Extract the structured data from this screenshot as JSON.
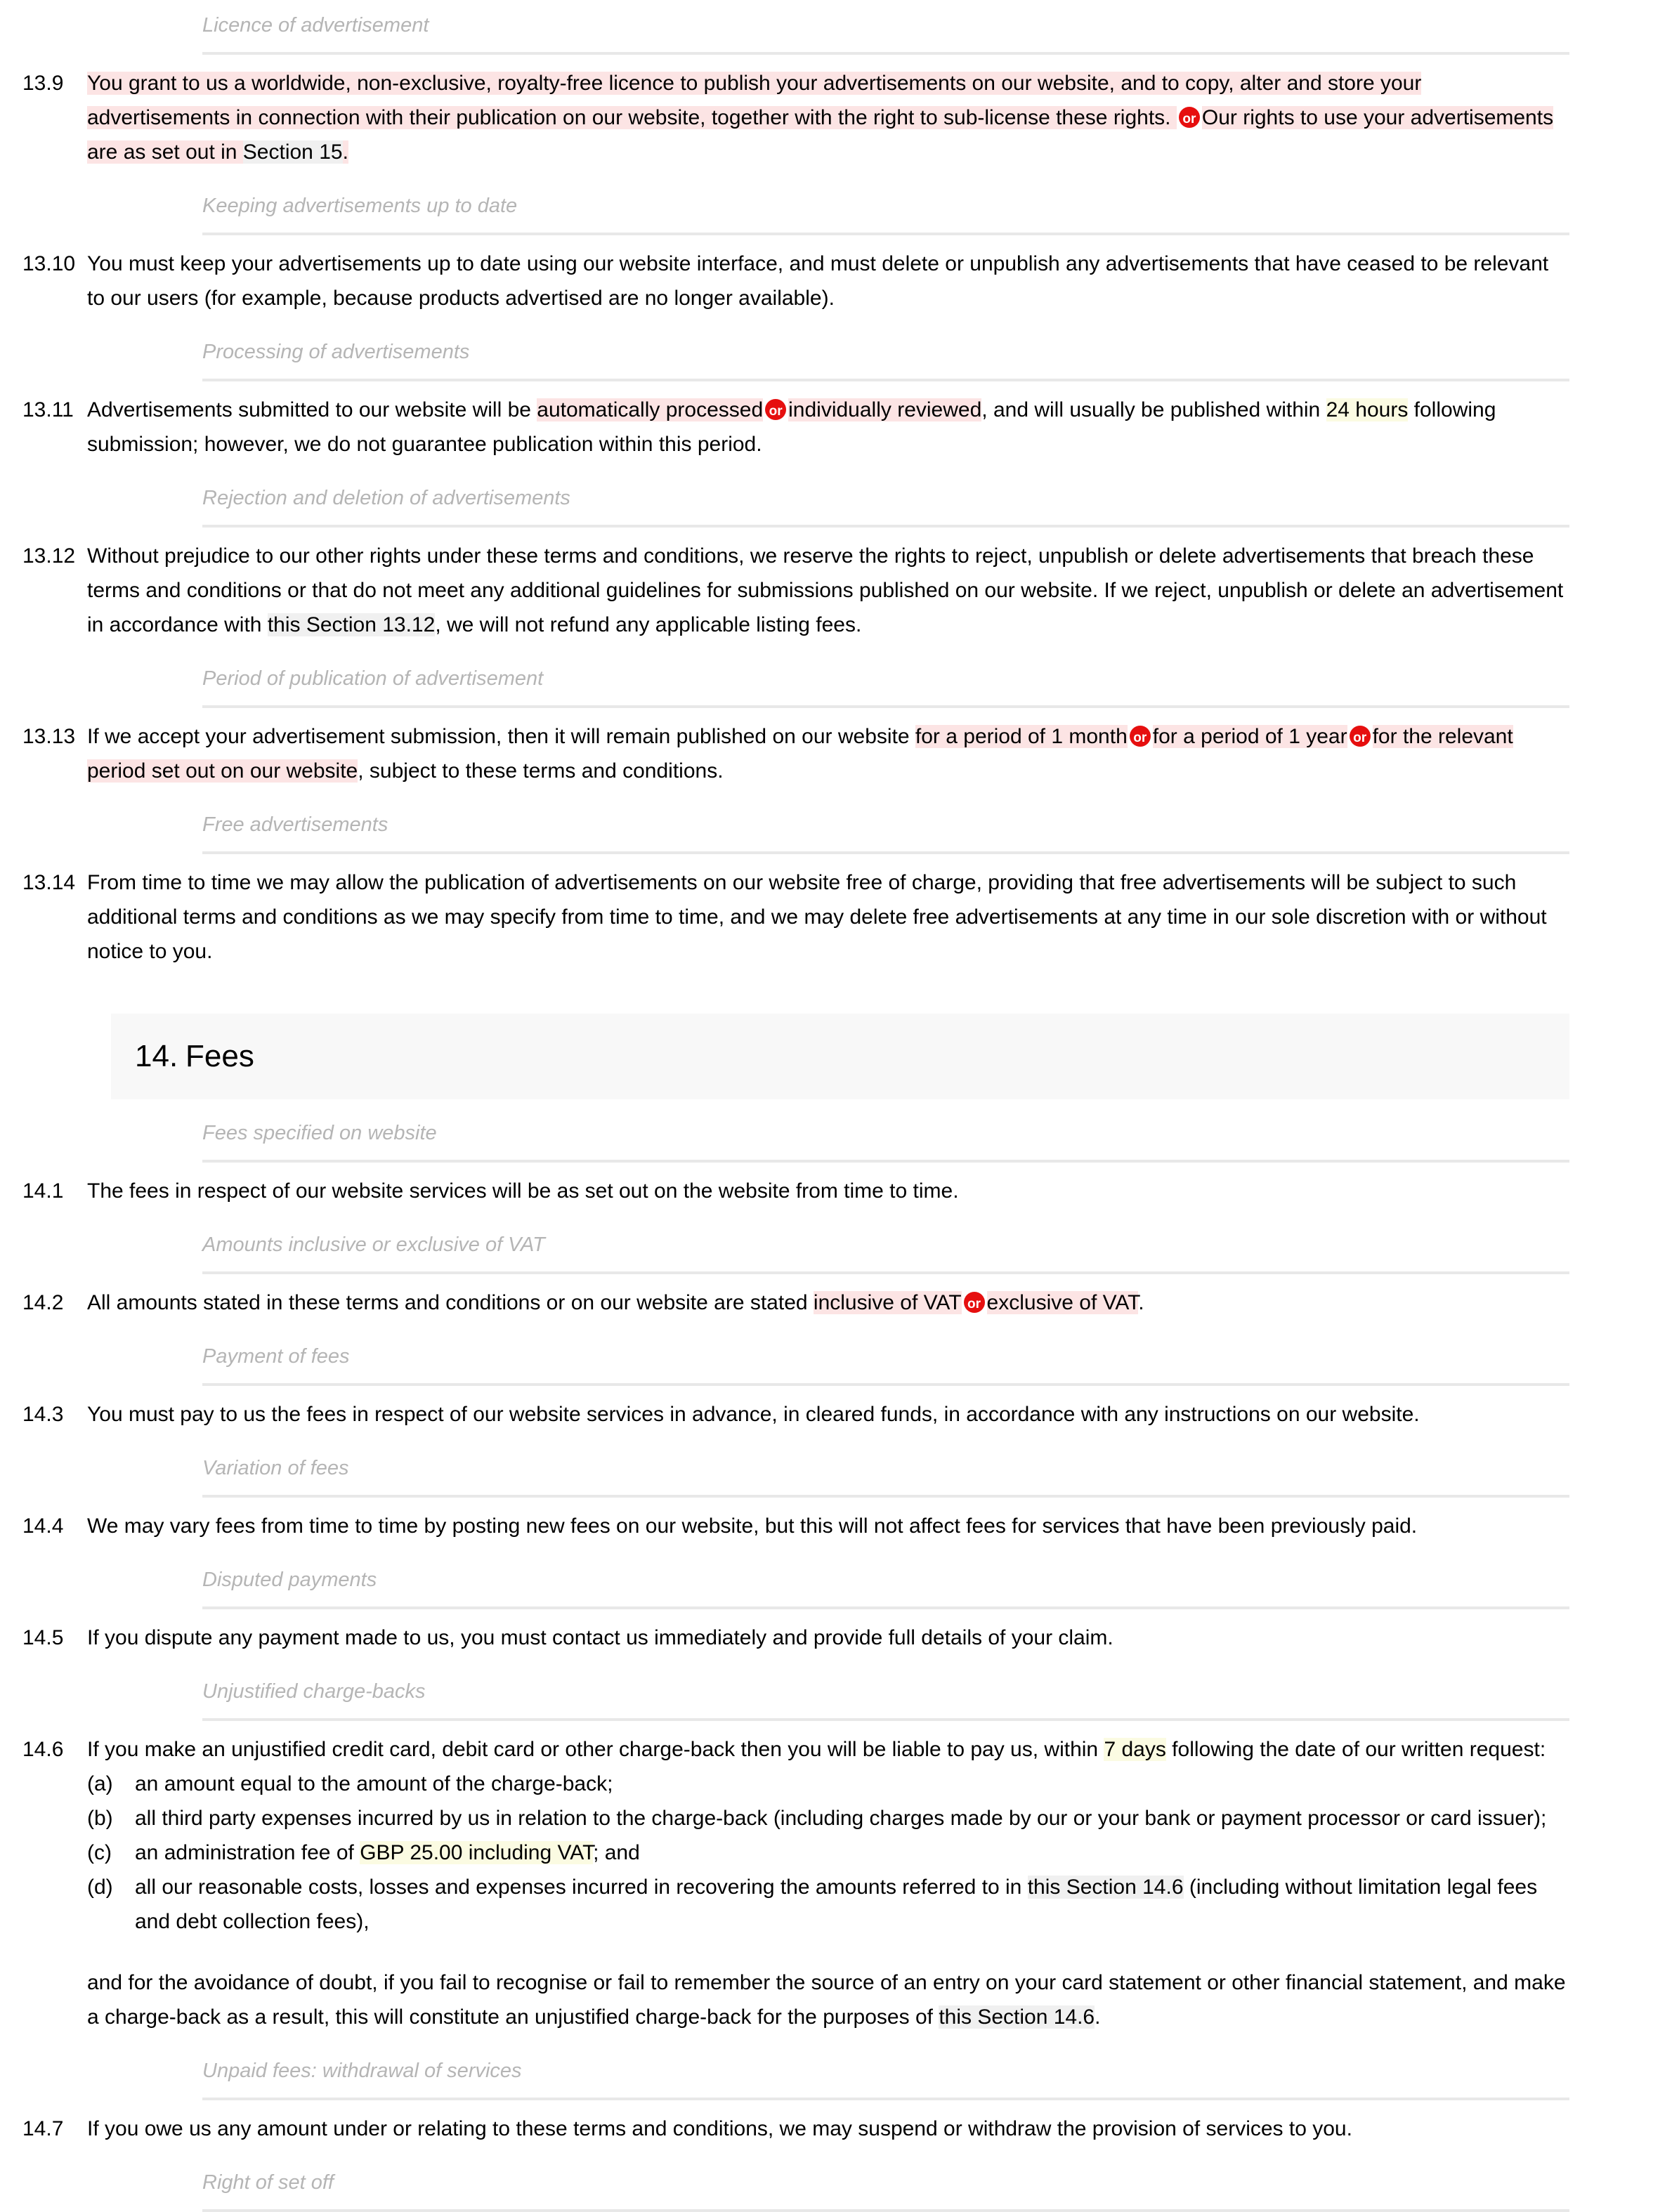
{
  "document": {
    "type": "terms-and-conditions",
    "colors": {
      "option_highlight": "#fce4e4",
      "variable_highlight": "#fbfbe2",
      "crossref_highlight": "#f0f0f0",
      "or_badge": "#e60f0f",
      "subheading": "#b5b5b5",
      "section_banner": "#f8f8f8",
      "rule": "#e8e8e8"
    },
    "or_badge_label": "or"
  },
  "blocks": {
    "sub_licence": "Licence of advertisement",
    "c13_9_num": "13.9",
    "c13_9_a": "You grant to us a worldwide, non-exclusive, royalty-free licence to publish your advertisements on our website, and to copy, alter and store your advertisements in connection with their publication on our website, together with the right to sub-license these rights. ",
    "c13_9_b": "Our rights to use your advertisements are as set out in ",
    "c13_9_xref": "Section 15",
    "c13_9_c": ".",
    "sub_keeping": "Keeping advertisements up to date",
    "c13_10_num": "13.10",
    "c13_10": "You must keep your advertisements up to date using our website interface, and must delete or unpublish any advertisements that have ceased to be relevant to our users (for example, because products advertised are no longer available).",
    "sub_processing": "Processing of advertisements",
    "c13_11_num": "13.11",
    "c13_11_a": "Advertisements submitted to our website will be ",
    "c13_11_opt1": "automatically processed",
    "c13_11_opt2": "individually reviewed",
    "c13_11_b": ", and will usually be published within ",
    "c13_11_var": "24 hours",
    "c13_11_c": " following submission; however, we do not guarantee publication within this period.",
    "sub_rejection": "Rejection and deletion of advertisements",
    "c13_12_num": "13.12",
    "c13_12_a": "Without prejudice to our other rights under these terms and conditions, we reserve the rights to reject, unpublish or delete advertisements that breach these terms and conditions or that do not meet any additional guidelines for submissions published on our website. If we reject, unpublish or delete an advertisement in accordance with ",
    "c13_12_xref": "this Section 13.12",
    "c13_12_b": ", we will not refund any applicable listing fees.",
    "sub_period": "Period of publication of advertisement",
    "c13_13_num": "13.13",
    "c13_13_a": "If we accept your advertisement submission, then it will remain published on our website ",
    "c13_13_opt1": "for a period of 1 month",
    "c13_13_opt2": "for a period of 1 year",
    "c13_13_opt3": "for the relevant period set out on our website",
    "c13_13_b": ", subject to these terms and conditions.",
    "sub_free": "Free advertisements",
    "c13_14_num": "13.14",
    "c13_14": "From time to time we may allow the publication of advertisements on our website free of charge, providing that free advertisements will be subject to such additional terms and conditions as we may specify from time to time, and we may delete free advertisements at any time in our sole discretion with or without notice to you.",
    "section_14_num": "14.",
    "section_14_title": "Fees",
    "sub_fees_specified": "Fees specified on website",
    "c14_1_num": "14.1",
    "c14_1": "The fees in respect of our website services will be as set out on the website from time to time.",
    "sub_vat": "Amounts inclusive or exclusive of VAT",
    "c14_2_num": "14.2",
    "c14_2_a": "All amounts stated in these terms and conditions or on our website are stated ",
    "c14_2_opt1": "inclusive of VAT",
    "c14_2_opt2": "exclusive of VAT",
    "c14_2_b": ".",
    "sub_payment": "Payment of fees",
    "c14_3_num": "14.3",
    "c14_3": "You must pay to us the fees in respect of our website services in advance, in cleared funds, in accordance with any instructions on our website.",
    "sub_variation": "Variation of fees",
    "c14_4_num": "14.4",
    "c14_4": "We may vary fees from time to time by posting new fees on our website, but this will not affect fees for services that have been previously paid.",
    "sub_disputed": "Disputed payments",
    "c14_5_num": "14.5",
    "c14_5": "If you dispute any payment made to us, you must contact us immediately and provide full details of your claim.",
    "sub_chargebacks": "Unjustified charge-backs",
    "c14_6_num": "14.6",
    "c14_6_a": "If you make an unjustified credit card, debit card or other charge-back then you will be liable to pay us, within ",
    "c14_6_var": "7 days",
    "c14_6_b": " following the date of our written request:",
    "c14_6_la": "(a)",
    "c14_6_ta": "an amount equal to the amount of the charge-back;",
    "c14_6_lb": "(b)",
    "c14_6_tb": "all third party expenses incurred by us in relation to the charge-back (including charges made by our or your bank or payment processor or card issuer);",
    "c14_6_lc": "(c)",
    "c14_6_tc1": "an administration fee of ",
    "c14_6_tc_var": "GBP 25.00 including VAT",
    "c14_6_tc2": "; and",
    "c14_6_ld": "(d)",
    "c14_6_td1": "all our reasonable costs, losses and expenses incurred in recovering the amounts referred to in ",
    "c14_6_td_xref": "this Section 14.6",
    "c14_6_td2": " (including without limitation legal fees and debt collection fees),",
    "c14_6_tail1": "and for the avoidance of doubt, if you fail to recognise or fail to remember the source of an entry on your card statement or other financial statement, and make a charge-back as a result, this will constitute an unjustified charge-back for the purposes of ",
    "c14_6_tail_xref": "this Section 14.6",
    "c14_6_tail2": ".",
    "sub_unpaid": "Unpaid fees: withdrawal of services",
    "c14_7_num": "14.7",
    "c14_7": "If you owe us any amount under or relating to these terms and conditions, we may suspend or withdraw the provision of services to you.",
    "sub_setoff": "Right of set off"
  }
}
